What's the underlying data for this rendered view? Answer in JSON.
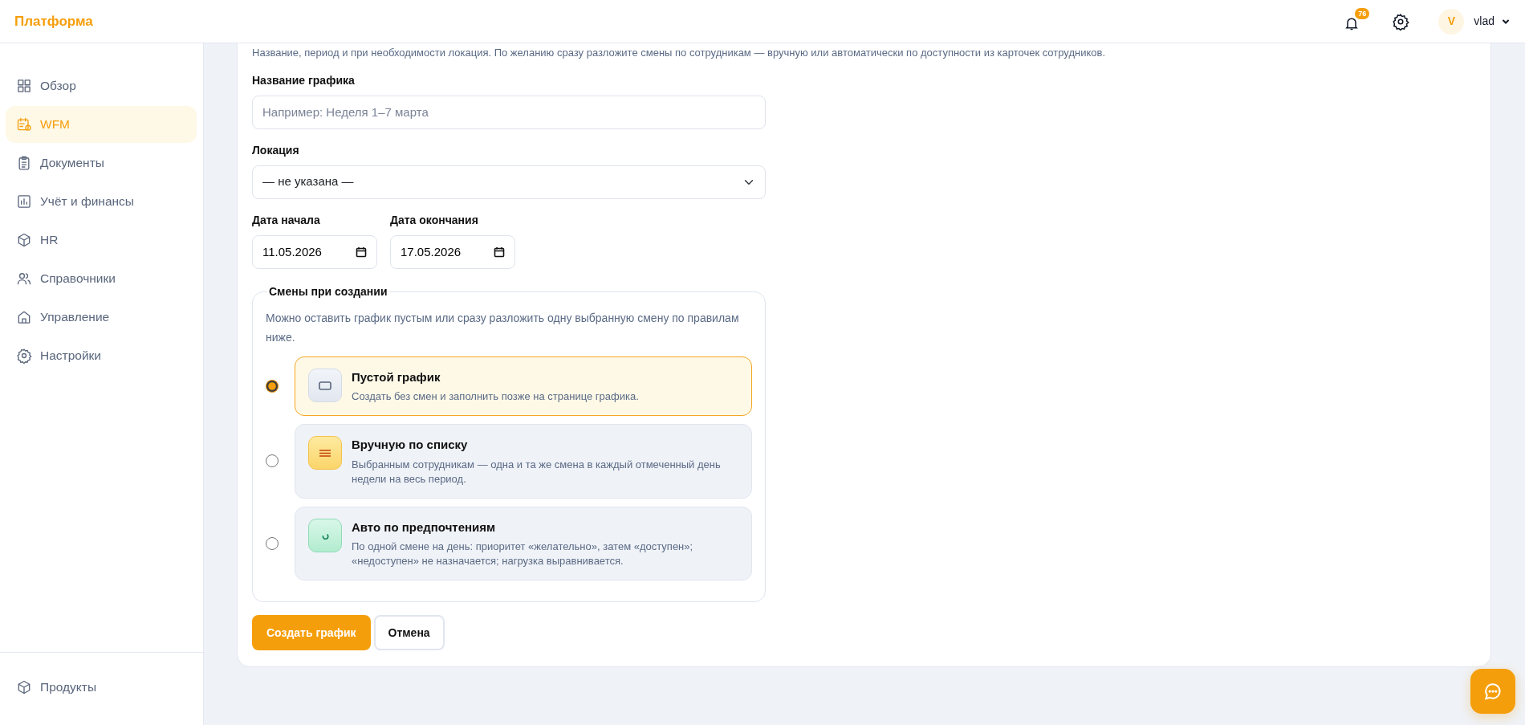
{
  "header": {
    "brand": "Платформа",
    "notifications_badge": "76",
    "avatar_initial": "V",
    "user_name": "vlad"
  },
  "sidebar": {
    "items": [
      {
        "kind": "grid",
        "label": "Обзор",
        "selected": false
      },
      {
        "kind": "calendar",
        "label": "WFM",
        "selected": true
      },
      {
        "kind": "clipboard",
        "label": "Документы",
        "selected": false
      },
      {
        "kind": "chart",
        "label": "Учёт и финансы",
        "selected": false
      },
      {
        "kind": "cube",
        "label": "HR",
        "selected": false
      },
      {
        "kind": "users",
        "label": "Справочники",
        "selected": false
      },
      {
        "kind": "home",
        "label": "Управление",
        "selected": false
      },
      {
        "kind": "gear",
        "label": "Настройки",
        "selected": false
      }
    ],
    "footer_items": [
      {
        "kind": "cube",
        "label": "Продукты",
        "selected": false
      }
    ]
  },
  "form": {
    "description": "Название, период и при необходимости локация. По желанию сразу разложите смены по сотрудникам — вручную или автоматически по доступности из карточек сотрудников.",
    "name_field": {
      "label": "Название графика",
      "placeholder": "Например: Неделя 1–7 марта"
    },
    "location_field": {
      "label": "Локация",
      "value": "— не указана —"
    },
    "start_date": {
      "label": "Дата начала",
      "value": "11.05.2026"
    },
    "end_date": {
      "label": "Дата окончания",
      "value": "17.05.2026"
    },
    "shifts": {
      "legend": "Смены при создании",
      "hint": "Можно оставить график пустым или сразу разложить одну выбранную смену по правилам ниже.",
      "options": [
        {
          "kind": "empty",
          "title": "Пустой график",
          "description": "Создать без смен и заполнить позже на странице графика.",
          "selected": true
        },
        {
          "kind": "list",
          "title": "Вручную по списку",
          "description": "Выбранным сотрудникам — одна и та же смена в каждый отмеченный день недели на весь период.",
          "selected": false
        },
        {
          "kind": "auto",
          "title": "Авто по предпочтениям",
          "description": "По одной смене на день: приоритет «желательно», затем «доступен»; «недоступен» не назначается; нагрузка выравнивается.",
          "selected": false
        }
      ]
    },
    "buttons": {
      "submit": "Создать график",
      "cancel": "Отмена"
    }
  }
}
